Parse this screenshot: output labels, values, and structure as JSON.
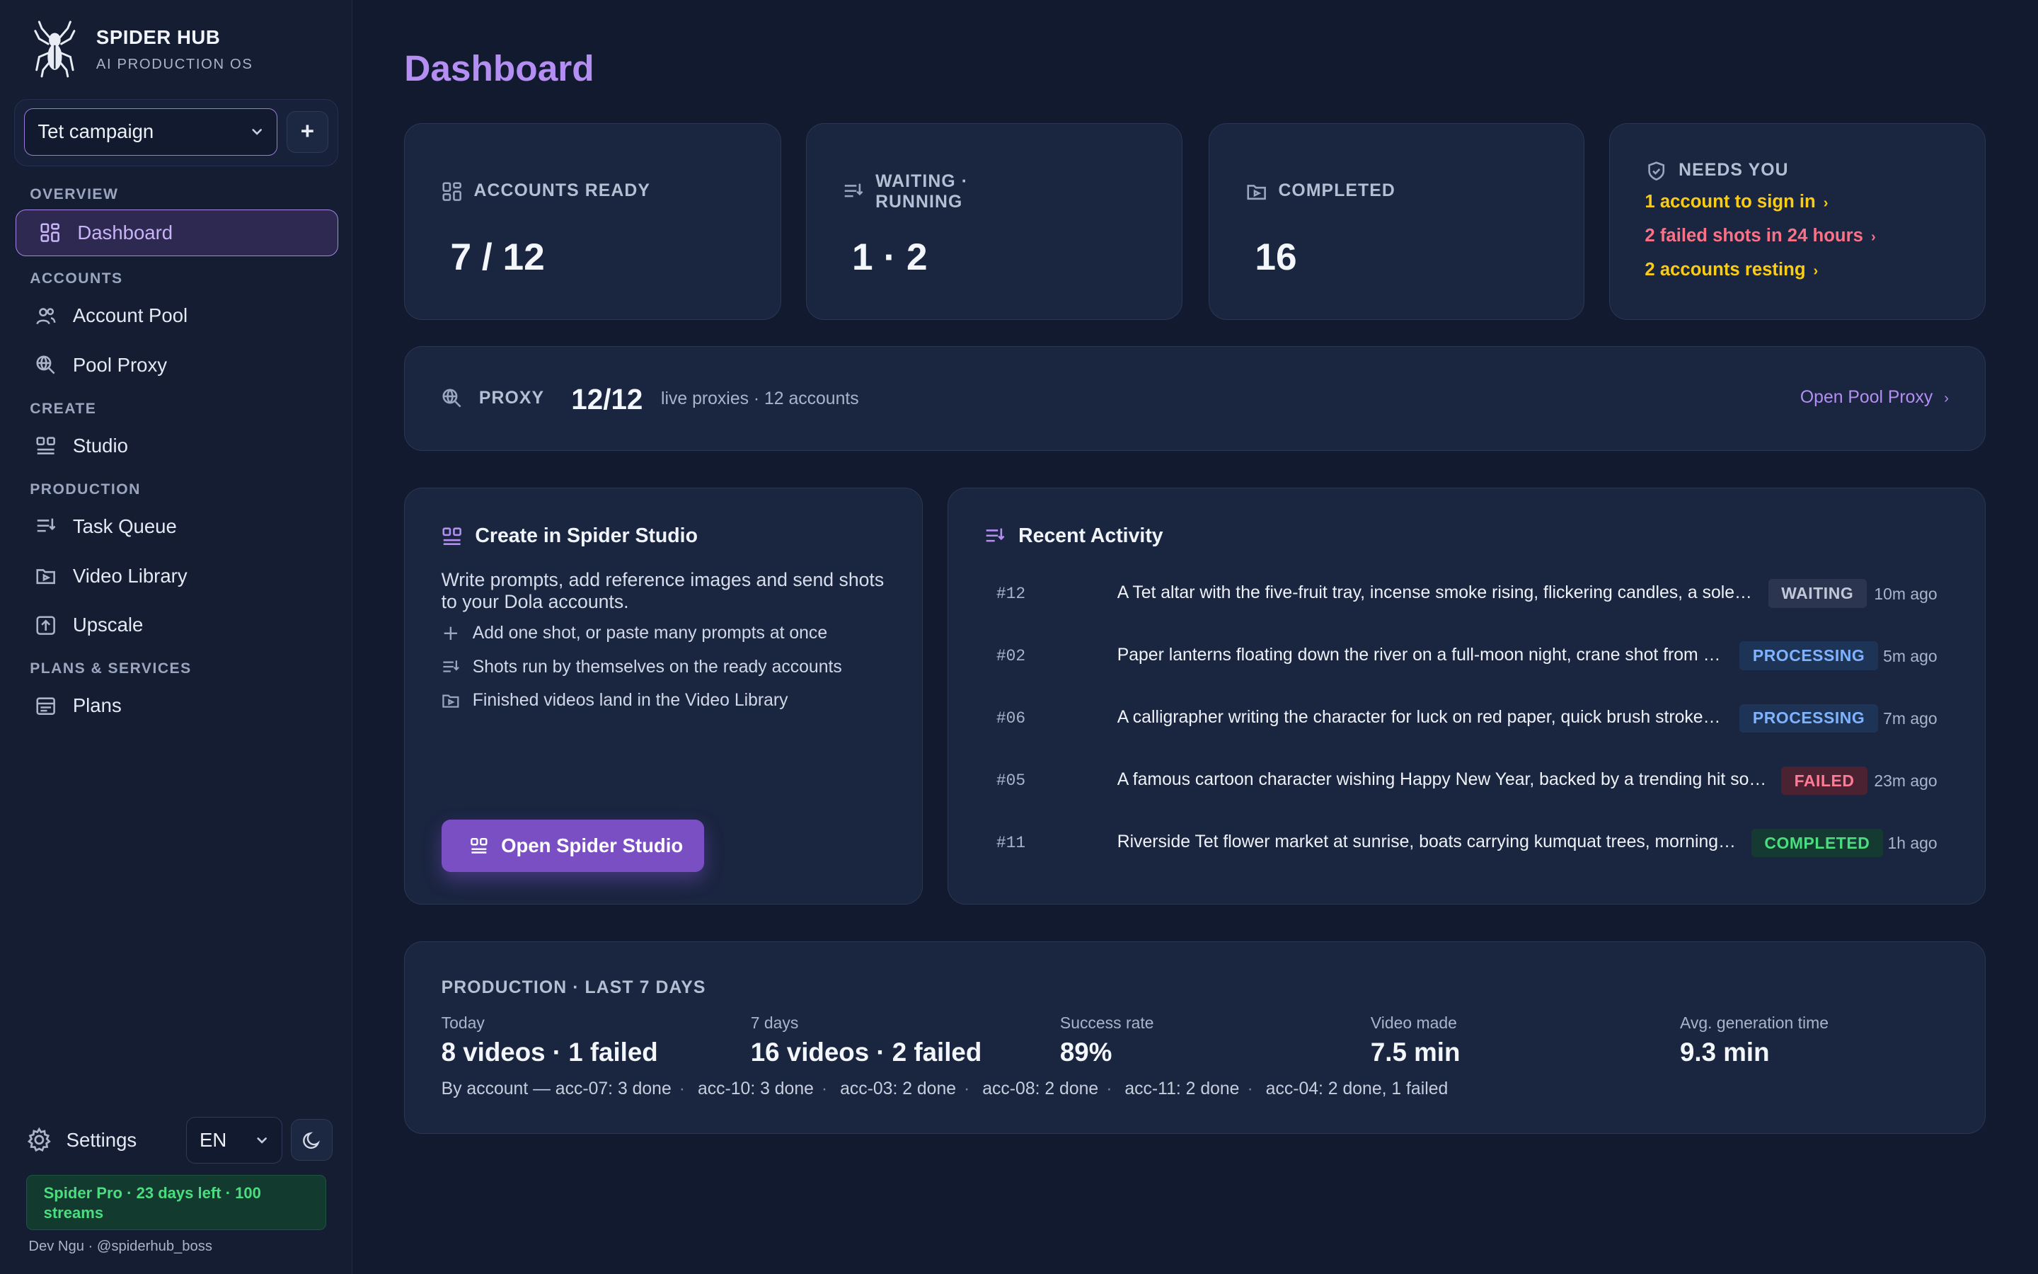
{
  "brand": {
    "title": "SPIDER HUB",
    "subtitle": "AI PRODUCTION OS"
  },
  "campaign": {
    "selected": "Tet campaign",
    "add_label": "+"
  },
  "nav": {
    "overview_label": "OVERVIEW",
    "dashboard": "Dashboard",
    "accounts_label": "ACCOUNTS",
    "account_pool": "Account Pool",
    "pool_proxy": "Pool Proxy",
    "create_label": "CREATE",
    "studio": "Studio",
    "production_label": "PRODUCTION",
    "task_queue": "Task Queue",
    "video_library": "Video Library",
    "upscale": "Upscale",
    "plans_label": "PLANS & SERVICES",
    "plans": "Plans"
  },
  "footer": {
    "settings": "Settings",
    "language": "EN",
    "plan_badge": "Spider Pro · 23 days left · 100 streams",
    "user": "Dev Ngu · @spiderhub_boss"
  },
  "page": {
    "title": "Dashboard"
  },
  "stats": {
    "accounts_ready": {
      "label": "ACCOUNTS READY",
      "value": "7 / 12"
    },
    "waiting_running": {
      "label_1": "WAITING ·",
      "label_2": "RUNNING",
      "value": "1 · 2"
    },
    "completed": {
      "label": "COMPLETED",
      "value": "16"
    }
  },
  "needs_you": {
    "label": "NEEDS YOU",
    "items": [
      {
        "text": "1 account to sign in",
        "arrow": "›",
        "color": "#facc15"
      },
      {
        "text": "2 failed shots in 24 hours",
        "arrow": "›",
        "color": "#fb7185"
      },
      {
        "text": "2 accounts resting",
        "arrow": "›",
        "color": "#facc15"
      }
    ]
  },
  "proxy": {
    "label": "PROXY",
    "value": "12/12",
    "desc": "live proxies · 12 accounts",
    "link": "Open Pool Proxy",
    "link_arrow": "›"
  },
  "studio": {
    "title": "Create in Spider Studio",
    "desc": "Write prompts, add reference images and send shots to your Dola accounts.",
    "features": [
      "Add one shot, or paste many prompts at once",
      "Shots run by themselves on the ready accounts",
      "Finished videos land in the Video Library"
    ],
    "button": "Open Spider Studio"
  },
  "activity": {
    "title": "Recent Activity",
    "rows": [
      {
        "id": "#12",
        "text": "A Tet altar with the five-fruit tray, incense smoke rising, flickering candles, a solemn atmosphere",
        "status": "WAITING",
        "time": "10m ago"
      },
      {
        "id": "#02",
        "text": "Paper lanterns floating down the river on a full-moon night, crane shot from above",
        "status": "PROCESSING",
        "time": "5m ago"
      },
      {
        "id": "#06",
        "text": "A calligrapher writing the character for luck on red paper, quick brush strokes, close-up",
        "status": "PROCESSING",
        "time": "7m ago"
      },
      {
        "id": "#05",
        "text": "A famous cartoon character wishing Happy New Year, backed by a trending hit song",
        "status": "FAILED",
        "time": "23m ago"
      },
      {
        "id": "#11",
        "text": "Riverside Tet flower market at sunrise, boats carrying kumquat trees, morning mist",
        "status": "COMPLETED",
        "time": "1h ago"
      }
    ]
  },
  "production": {
    "title": "PRODUCTION · LAST 7 DAYS",
    "metrics": [
      {
        "label": "Today",
        "value": "8 videos · 1 failed"
      },
      {
        "label": "7 days",
        "value": "16 videos · 2 failed"
      },
      {
        "label": "Success rate",
        "value": "89%"
      },
      {
        "label": "Video made",
        "value": "7.5 min"
      },
      {
        "label": "Avg. generation time",
        "value": "9.3 min"
      }
    ],
    "by_account_prefix": "By account —",
    "by_account": [
      "acc-07: 3 done",
      "acc-10: 3 done",
      "acc-03: 2 done",
      "acc-08: 2 done",
      "acc-11: 2 done",
      "acc-04: 2 done, 1 failed"
    ]
  }
}
